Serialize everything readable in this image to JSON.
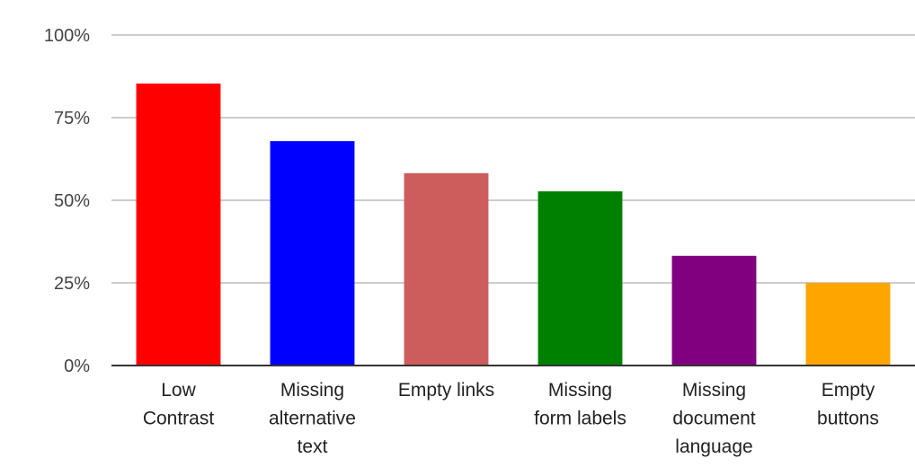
{
  "chart_data": {
    "type": "bar",
    "title": "",
    "xlabel": "",
    "ylabel": "",
    "categories": [
      [
        "Low",
        "Contrast"
      ],
      [
        "Missing",
        "alternative",
        "text"
      ],
      [
        "Empty links"
      ],
      [
        "Missing",
        "form labels"
      ],
      [
        "Missing",
        "document",
        "language"
      ],
      [
        "Empty",
        "buttons"
      ]
    ],
    "category_names": [
      "Low Contrast",
      "Missing alternative text",
      "Empty links",
      "Missing form labels",
      "Missing document language",
      "Empty buttons"
    ],
    "values": [
      85.3,
      67.9,
      58.2,
      52.7,
      33.2,
      25.0
    ],
    "colors": [
      "#ff0000",
      "#0000ff",
      "#cd5c5c",
      "#008000",
      "#800080",
      "#ffa500"
    ],
    "ylim": [
      0,
      100
    ],
    "yticks": [
      0,
      25,
      50,
      75,
      100
    ],
    "ytick_labels": [
      "0%",
      "25%",
      "50%",
      "75%",
      "100%"
    ],
    "grid": true,
    "legend": "none",
    "gridline_color": "#cccccc",
    "axis_color": "#333333"
  }
}
